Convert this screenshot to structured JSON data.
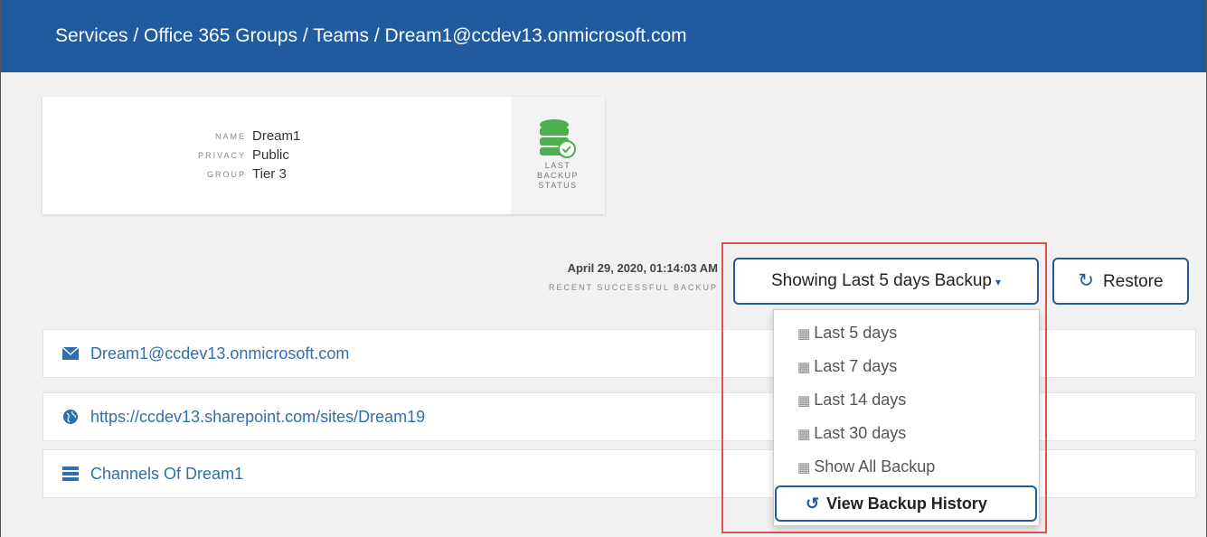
{
  "header": {
    "breadcrumb": "Services / Office 365 Groups / Teams / Dream1@ccdev13.onmicrosoft.com"
  },
  "info": {
    "name_label": "NAME",
    "name_value": "Dream1",
    "privacy_label": "PRIVACY",
    "privacy_value": "Public",
    "group_label": "GROUP",
    "group_value": "Tier 3",
    "status_label_1": "LAST",
    "status_label_2": "BACKUP",
    "status_label_3": "STATUS"
  },
  "backup": {
    "recent_date": "April 29, 2020, 01:14:03 AM",
    "recent_label": "RECENT SUCCESSFUL BACKUP",
    "dropdown_label": "Showing Last 5 days Backup",
    "restore_label": "Restore"
  },
  "menu": {
    "items": [
      "Last 5 days",
      "Last 7 days",
      "Last 14 days",
      "Last 30 days",
      "Show All Backup"
    ],
    "history_label": "View Backup History"
  },
  "links": {
    "email": "Dream1@ccdev13.onmicrosoft.com",
    "site": "https://ccdev13.sharepoint.com/sites/Dream19",
    "channels": "Channels Of Dream1"
  },
  "icons": {
    "status": "database-check-icon",
    "restore": "refresh-icon",
    "calendar": "calendar-icon",
    "history": "history-icon",
    "email": "envelope-icon",
    "site": "globe-icon",
    "channels": "list-icon"
  },
  "colors": {
    "brand": "#1f5b9e",
    "success": "#4caf50",
    "highlight": "#d9534f",
    "link": "#2f6fb0"
  }
}
